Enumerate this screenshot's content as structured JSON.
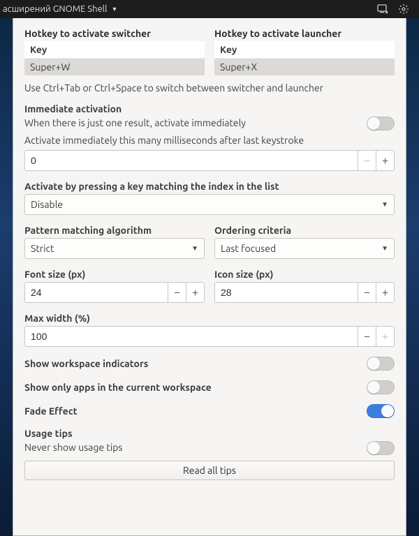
{
  "topbar": {
    "title": "асширений GNOME Shell"
  },
  "hotkeys": {
    "switcher": {
      "title": "Hotkey to activate switcher",
      "header": "Key",
      "value": "Super+W"
    },
    "launcher": {
      "title": "Hotkey to activate launcher",
      "header": "Key",
      "value": "Super+X"
    },
    "hint": "Use Ctrl+Tab or Ctrl+Space to switch between switcher and launcher"
  },
  "immediate": {
    "title": "Immediate activation",
    "one_result_label": "When there is just one result, activate immediately",
    "one_result_on": false,
    "delay_label": "Activate immediately this many milliseconds after last keystroke",
    "delay_value": "0"
  },
  "index_match": {
    "title": "Activate by pressing a key matching the index in the list",
    "value": "Disable"
  },
  "pattern": {
    "title": "Pattern matching algorithm",
    "value": "Strict"
  },
  "ordering": {
    "title": "Ordering criteria",
    "value": "Last focused"
  },
  "font_size": {
    "title": "Font size (px)",
    "value": "24"
  },
  "icon_size": {
    "title": "Icon size (px)",
    "value": "28"
  },
  "max_width": {
    "title": "Max width (%)",
    "value": "100"
  },
  "toggles": {
    "workspace_indicators": {
      "label": "Show workspace indicators",
      "on": false
    },
    "only_current_ws": {
      "label": "Show only apps in the current workspace",
      "on": false
    },
    "fade": {
      "label": "Fade Effect",
      "on": true
    }
  },
  "usage_tips": {
    "title": "Usage tips",
    "never_label": "Never show usage tips",
    "never_on": false,
    "read_all": "Read all tips"
  }
}
